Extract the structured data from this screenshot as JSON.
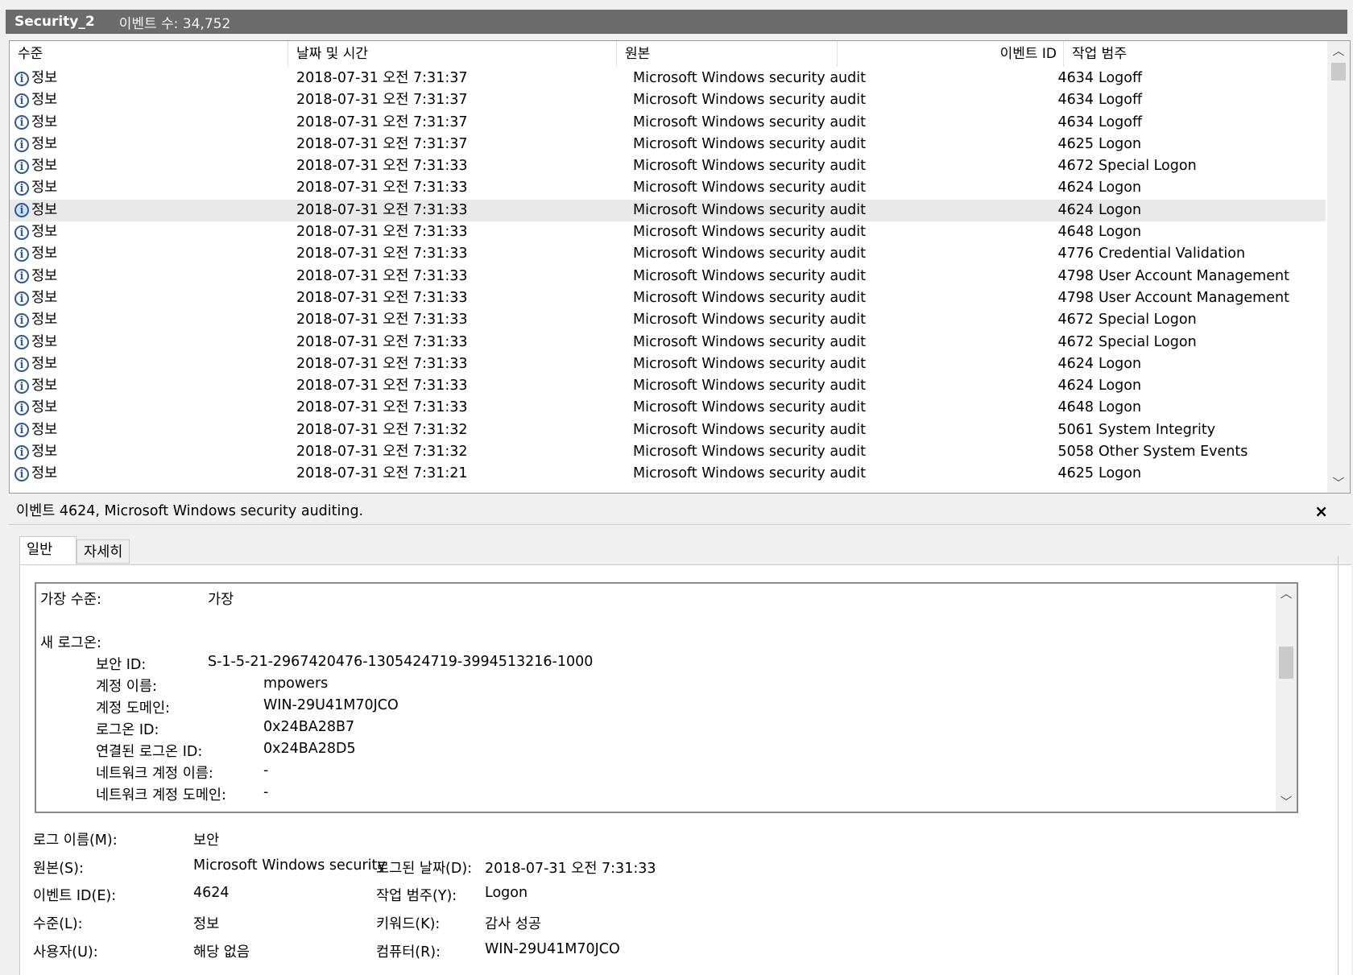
{
  "titlebar": {
    "title": "Security_2",
    "count": "이벤트 수: 34,752"
  },
  "columns": {
    "level": "수준",
    "date": "날짜 및 시간",
    "source": "원본",
    "event_id": "이벤트 ID",
    "category": "작업 범주"
  },
  "events": [
    {
      "level": "정보",
      "date": "2018-07-31 오전 7:31:37",
      "source": "Microsoft Windows security audit...",
      "id": "4634",
      "category": "Logoff"
    },
    {
      "level": "정보",
      "date": "2018-07-31 오전 7:31:37",
      "source": "Microsoft Windows security audit...",
      "id": "4634",
      "category": "Logoff"
    },
    {
      "level": "정보",
      "date": "2018-07-31 오전 7:31:37",
      "source": "Microsoft Windows security audit...",
      "id": "4634",
      "category": "Logoff"
    },
    {
      "level": "정보",
      "date": "2018-07-31 오전 7:31:37",
      "source": "Microsoft Windows security audit...",
      "id": "4625",
      "category": "Logon"
    },
    {
      "level": "정보",
      "date": "2018-07-31 오전 7:31:33",
      "source": "Microsoft Windows security audit...",
      "id": "4672",
      "category": "Special Logon"
    },
    {
      "level": "정보",
      "date": "2018-07-31 오전 7:31:33",
      "source": "Microsoft Windows security audit...",
      "id": "4624",
      "category": "Logon"
    },
    {
      "level": "정보",
      "date": "2018-07-31 오전 7:31:33",
      "source": "Microsoft Windows security audit...",
      "id": "4624",
      "category": "Logon",
      "selected": true
    },
    {
      "level": "정보",
      "date": "2018-07-31 오전 7:31:33",
      "source": "Microsoft Windows security audit...",
      "id": "4648",
      "category": "Logon"
    },
    {
      "level": "정보",
      "date": "2018-07-31 오전 7:31:33",
      "source": "Microsoft Windows security audit...",
      "id": "4776",
      "category": "Credential Validation"
    },
    {
      "level": "정보",
      "date": "2018-07-31 오전 7:31:33",
      "source": "Microsoft Windows security audit...",
      "id": "4798",
      "category": "User Account Management"
    },
    {
      "level": "정보",
      "date": "2018-07-31 오전 7:31:33",
      "source": "Microsoft Windows security audit...",
      "id": "4798",
      "category": "User Account Management"
    },
    {
      "level": "정보",
      "date": "2018-07-31 오전 7:31:33",
      "source": "Microsoft Windows security audit...",
      "id": "4672",
      "category": "Special Logon"
    },
    {
      "level": "정보",
      "date": "2018-07-31 오전 7:31:33",
      "source": "Microsoft Windows security audit...",
      "id": "4672",
      "category": "Special Logon"
    },
    {
      "level": "정보",
      "date": "2018-07-31 오전 7:31:33",
      "source": "Microsoft Windows security audit...",
      "id": "4624",
      "category": "Logon"
    },
    {
      "level": "정보",
      "date": "2018-07-31 오전 7:31:33",
      "source": "Microsoft Windows security audit...",
      "id": "4624",
      "category": "Logon"
    },
    {
      "level": "정보",
      "date": "2018-07-31 오전 7:31:33",
      "source": "Microsoft Windows security audit...",
      "id": "4648",
      "category": "Logon"
    },
    {
      "level": "정보",
      "date": "2018-07-31 오전 7:31:32",
      "source": "Microsoft Windows security audit...",
      "id": "5061",
      "category": "System Integrity"
    },
    {
      "level": "정보",
      "date": "2018-07-31 오전 7:31:32",
      "source": "Microsoft Windows security audit...",
      "id": "5058",
      "category": "Other System Events"
    },
    {
      "level": "정보",
      "date": "2018-07-31 오전 7:31:21",
      "source": "Microsoft Windows security audit...",
      "id": "4625",
      "category": "Logon"
    }
  ],
  "icons": {
    "level_icon": "info-icon",
    "scroll_up": "chevron-up-icon",
    "scroll_down": "chevron-down-icon",
    "close": "close-icon"
  },
  "detail": {
    "header": "이벤트 4624, Microsoft Windows security auditing.",
    "close_glyph": "×",
    "tabs": [
      "일반",
      "자세히"
    ],
    "text": {
      "elevated_label": "가장 수준:",
      "elevated_value": "가장",
      "new_logon_label": "새 로그온:",
      "fields": [
        {
          "label": "보안 ID:",
          "value": "S-1-5-21-2967420476-1305424719-3994513216-1000"
        },
        {
          "label": "계정 이름:",
          "value": "mpowers"
        },
        {
          "label": "계정 도메인:",
          "value": "WIN-29U41M70JCO"
        },
        {
          "label": "로그온 ID:",
          "value": "0x24BA28B7"
        },
        {
          "label": "연결된 로그온 ID:",
          "value": "0x24BA28D5"
        },
        {
          "label": "네트워크 계정 이름:",
          "value": "-"
        },
        {
          "label": "네트워크 계정 도메인:",
          "value": "-"
        }
      ]
    },
    "props": {
      "log_name_label": "로그 이름(M):",
      "log_name": "보안",
      "source_label": "원본(S):",
      "source": "Microsoft Windows security",
      "logged_label": "로그된 날짜(D):",
      "logged": "2018-07-31 오전 7:31:33",
      "event_id_label": "이벤트 ID(E):",
      "event_id": "4624",
      "task_label": "작업 범주(Y):",
      "task": "Logon",
      "level_label": "수준(L):",
      "level": "정보",
      "keywords_label": "키워드(K):",
      "keywords": "감사 성공",
      "user_label": "사용자(U):",
      "user": "해당 없음",
      "computer_label": "컴퓨터(R):",
      "computer": "WIN-29U41M70JCO"
    }
  }
}
